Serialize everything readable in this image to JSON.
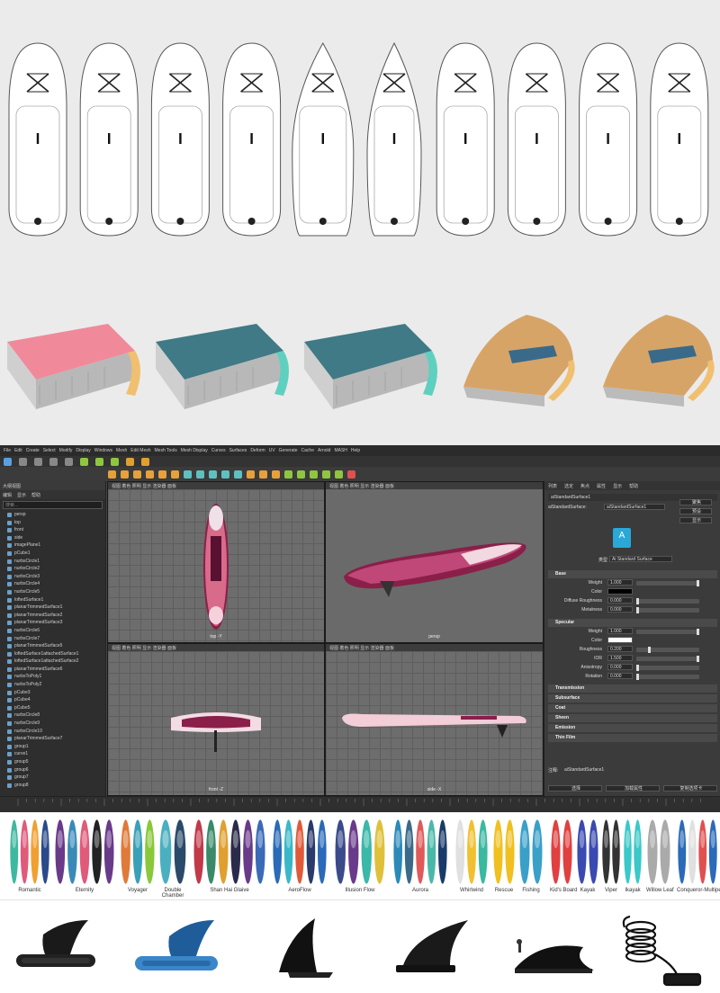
{
  "outline_section": {
    "boards": [
      {
        "shape": "round"
      },
      {
        "shape": "round"
      },
      {
        "shape": "round"
      },
      {
        "shape": "round"
      },
      {
        "shape": "pointed"
      },
      {
        "shape": "narrow"
      },
      {
        "shape": "round"
      },
      {
        "shape": "round"
      },
      {
        "shape": "round"
      },
      {
        "shape": "round"
      }
    ]
  },
  "cross_sections": [
    {
      "deck_color": "#f08a9a",
      "rail_color": "#f0c070"
    },
    {
      "deck_color": "#3f7a86",
      "rail_color": "#5fd0c0"
    },
    {
      "deck_color": "#3f7a86",
      "rail_color": "#5fd0c0"
    },
    {
      "deck_color": "#d7a468",
      "rail_color": "#f0c070"
    },
    {
      "deck_color": "#d7a468",
      "rail_color": "#f0c070"
    }
  ],
  "maya": {
    "menu_top": [
      "File",
      "Edit",
      "Create",
      "Select",
      "Modify",
      "Display",
      "Windows",
      "Mesh",
      "Edit Mesh",
      "Mesh Tools",
      "Mesh Display",
      "Curves",
      "Surfaces",
      "Deform",
      "UV",
      "Generate",
      "Cache",
      "Arnold",
      "MASH",
      "Help"
    ],
    "menu_second": [
      "视图",
      "着色",
      "照明",
      "显示",
      "渲染器",
      "面板"
    ],
    "outliner": {
      "header": "大纲视图",
      "menu": [
        "编辑",
        "显示",
        "帮助"
      ],
      "search_placeholder": "搜索...",
      "items": [
        "persp",
        "top",
        "front",
        "side",
        "imagePlane1",
        "pCube1",
        "nurbsCircle1",
        "nurbsCircle2",
        "nurbsCircle3",
        "nurbsCircle4",
        "nurbsCircle5",
        "loftedSurface1",
        "planarTrimmedSurface1",
        "planarTrimmedSurface2",
        "planarTrimmedSurface3",
        "nurbsCircle6",
        "nurbsCircle7",
        "planarTrimmedSurface5",
        "loftedSurface1attachedSurface1",
        "loftedSurface1attachedSurface2",
        "planarTrimmedSurface6",
        "nurbsToPoly1",
        "nurbsToPoly2",
        "pCube3",
        "pCube4",
        "pCube5",
        "nurbsCircle8",
        "nurbsCircle9",
        "nurbsCircle10",
        "planarTrimmedSurface7",
        "group1",
        "curve1",
        "group5",
        "group6",
        "group7",
        "group8"
      ]
    },
    "viewports": [
      {
        "label": "top -Y",
        "menu": "视图 着色 照明 显示 渲染器 面板"
      },
      {
        "label": "persp",
        "menu": "视图 着色 照明 显示 渲染器 面板"
      },
      {
        "label": "front -Z",
        "menu": "视图 着色 照明 显示 渲染器 面板"
      },
      {
        "label": "side -X",
        "menu": "视图 着色 照明 显示 渲染器 面板"
      }
    ],
    "attribute_editor": {
      "tabs": [
        "列表",
        "选定",
        "焦点",
        "属性",
        "显示",
        "帮助"
      ],
      "node_name_label": "aiStandardSurface:",
      "node_name": "aiStandardSurface1",
      "buttons": [
        "聚焦",
        "预设",
        "显示"
      ],
      "type_label": "类型",
      "type_value": "Ai Standard Surface",
      "sections": {
        "base": "Base",
        "specular": "Specular",
        "collapsed": [
          "Transmission",
          "Subsurface",
          "Coat",
          "Sheen",
          "Emission",
          "Thin Film"
        ]
      },
      "base": [
        {
          "label": "Weight",
          "value": "1.000"
        },
        {
          "label": "Color",
          "value": ""
        },
        {
          "label": "Diffuse Roughness",
          "value": "0.000"
        },
        {
          "label": "Metalness",
          "value": "0.000"
        }
      ],
      "specular": [
        {
          "label": "Weight",
          "value": "1.000"
        },
        {
          "label": "Color",
          "value": ""
        },
        {
          "label": "Roughness",
          "value": "0.200"
        },
        {
          "label": "IOR",
          "value": "1.500"
        },
        {
          "label": "Anisotropy",
          "value": "0.000"
        },
        {
          "label": "Rotation",
          "value": "0.000"
        }
      ],
      "note_label": "注释:",
      "note_value": "aiStandardSurface1",
      "bottom_buttons": [
        "选择",
        "加载属性",
        "复制选项卡"
      ]
    }
  },
  "catalog": {
    "series": [
      "Romantic",
      "Eternity",
      "Voyager",
      "Double\nChamber",
      "Shan Hai Glaive",
      "AeroFlow",
      "Illusion Flow",
      "Aurora",
      "Whirlwind",
      "Rescue",
      "Fishing",
      "Kid's Board",
      "Kayak",
      "Viper",
      "Ikayak",
      "Willow Leaf",
      "Conqueror-Multipers"
    ]
  },
  "accessories": [
    {
      "name": "fin-black-slide"
    },
    {
      "name": "fin-blue-slide"
    },
    {
      "name": "fin-large-black"
    },
    {
      "name": "fin-us-box"
    },
    {
      "name": "fin-flat-kayak"
    },
    {
      "name": "coiled-leash"
    }
  ]
}
